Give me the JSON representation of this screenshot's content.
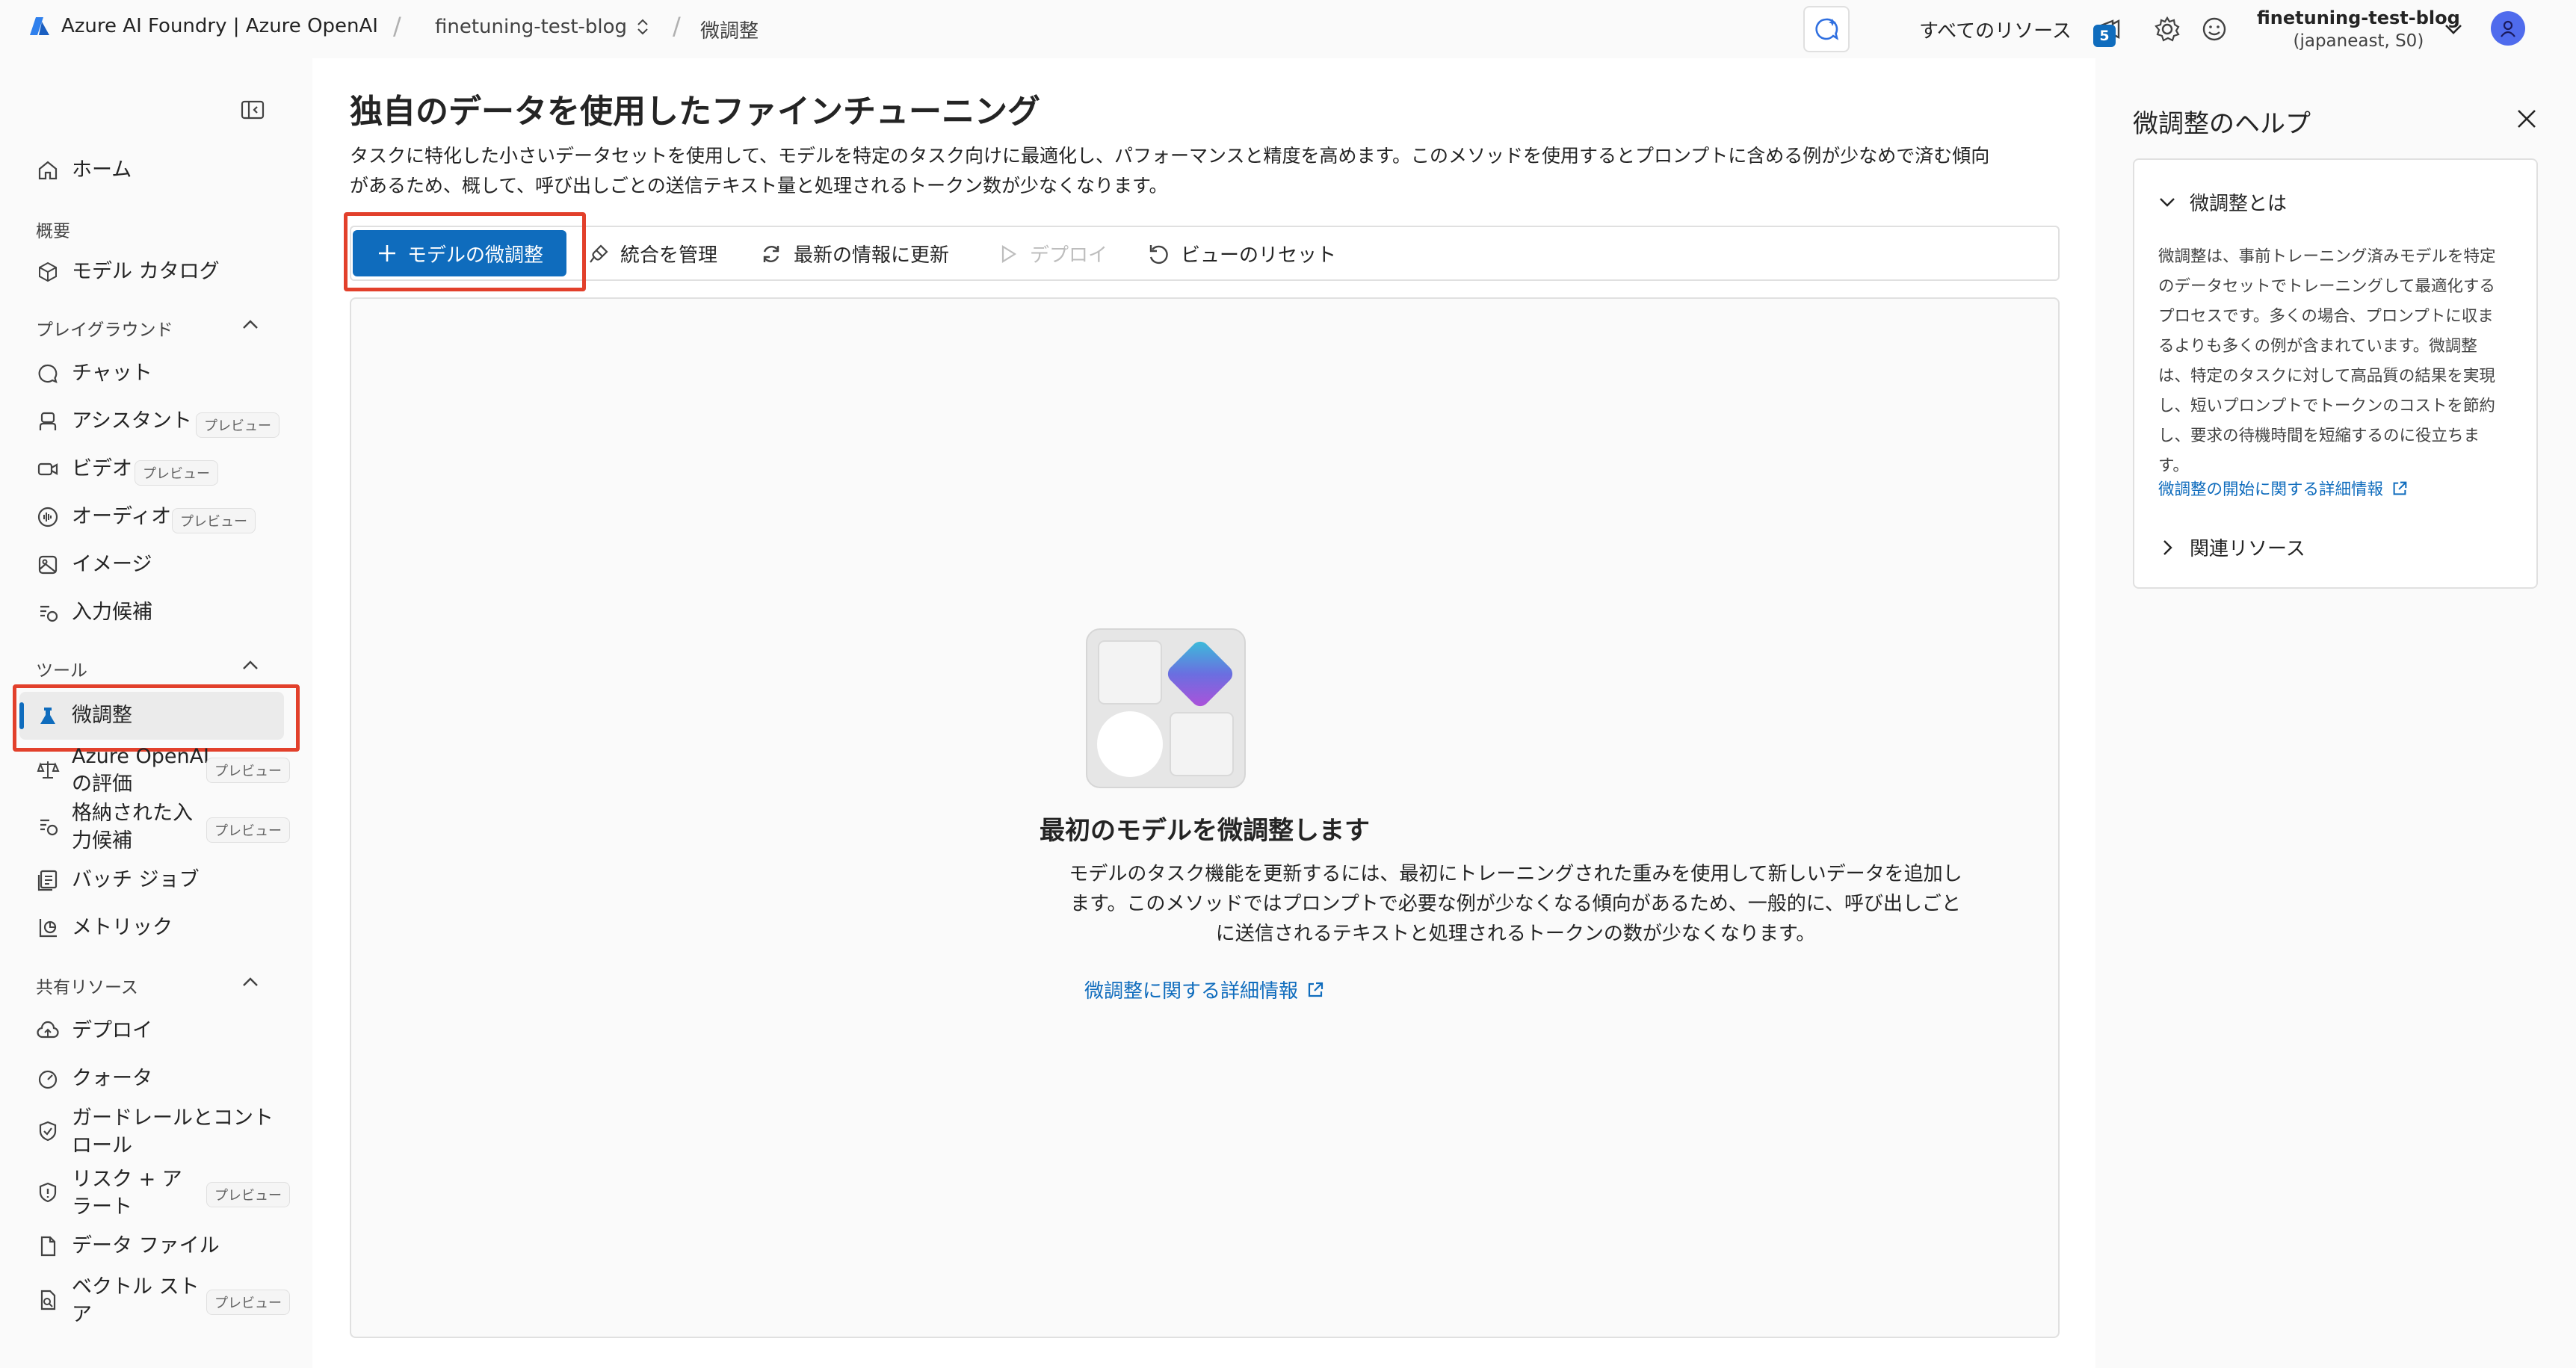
{
  "topbar": {
    "brand": "Azure AI Foundry | Azure OpenAI",
    "project_crumb": "finetuning-test-blog",
    "page_crumb": "微調整",
    "all_resources": "すべてのリソース",
    "notification_count": "5",
    "project_name": "finetuning-test-blog",
    "project_region": "(japaneast, S0)"
  },
  "sidebar": {
    "home": "ホーム",
    "sections": {
      "overview": "概要",
      "playground": "プレイグラウンド",
      "tools": "ツール",
      "shared": "共有リソース"
    },
    "preview_tag": "プレビュー",
    "items": {
      "model_catalog": "モデル カタログ",
      "chat": "チャット",
      "assistant": "アシスタント",
      "video": "ビデオ",
      "audio": "オーディオ",
      "image": "イメージ",
      "completions": "入力候補",
      "finetune": "微調整",
      "evaluation_1": "Azure OpenAI",
      "evaluation_2": "の評価",
      "stored_1": "格納された入",
      "stored_2": "力候補",
      "batch": "バッチ ジョブ",
      "metrics": "メトリック",
      "deploy": "デプロイ",
      "quota": "クォータ",
      "guardrails_1": "ガードレールとコント",
      "guardrails_2": "ロール",
      "risk_1": "リスク + ア",
      "risk_2": "ラート",
      "data_files": "データ ファイル",
      "vector_1": "ベクトル スト",
      "vector_2": "ア"
    }
  },
  "main": {
    "title": "独自のデータを使用したファインチューニング",
    "desc_line1": "タスクに特化した小さいデータセットを使用して、モデルを特定のタスク向けに最適化し、パフォーマンスと精度を高めます。このメソッドを使用するとプロンプトに含める例が少なめで済む傾向",
    "desc_line2": "があるため、概して、呼び出しごとの送信テキスト量と処理されるトークン数が少なくなります。",
    "toolbar": {
      "finetune_model": "モデルの微調整",
      "manage_integrations": "統合を管理",
      "refresh": "最新の情報に更新",
      "deploy": "デプロイ",
      "reset_view": "ビューのリセット"
    },
    "empty": {
      "title": "最初のモデルを微調整します",
      "desc_line1": "モデルのタスク機能を更新するには、最初にトレーニングされた重みを使用して新しいデータを追加し",
      "desc_line2": "ます。このメソッドではプロンプトで必要な例が少なくなる傾向があるため、一般的に、呼び出しごと",
      "desc_line3": "に送信されるテキストと処理されるトークンの数が少なくなります。",
      "link": "微調整に関する詳細情報"
    }
  },
  "help": {
    "title": "微調整のヘルプ",
    "what_is": "微調整とは",
    "lines": [
      "微調整は、事前トレーニング済みモデルを特定",
      "のデータセットでトレーニングして最適化する",
      "プロセスです。多くの場合、プロンプトに収ま",
      "るよりも多くの例が含まれています。微調整",
      "は、特定のタスクに対して高品質の結果を実現",
      "し、短いプロンプトでトークンのコストを節約",
      "し、要求の待機時間を短縮するのに役立ちま",
      "す。"
    ],
    "link": "微調整の開始に関する詳細情報",
    "related": "関連リソース"
  },
  "colors": {
    "accent": "#0f6cbd",
    "highlight": "#e2402b"
  }
}
